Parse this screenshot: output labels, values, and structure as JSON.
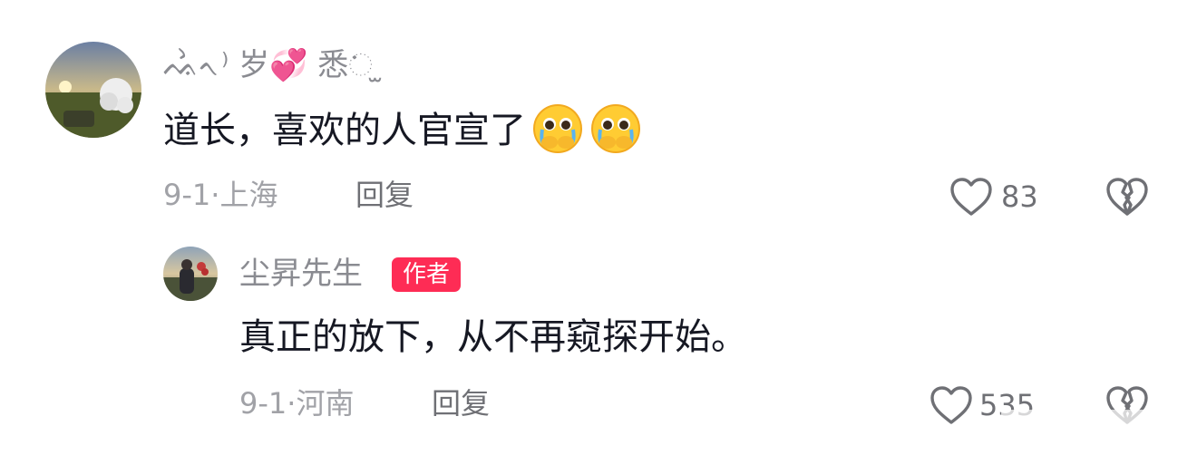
{
  "comment": {
    "username": "ᨕᨛᨚ⁾ 岁💞 悉ᨗ ̫",
    "text": "道长，喜欢的人官宣了",
    "emojis": [
      "pleading-crying-face",
      "pleading-crying-face"
    ],
    "date": "9-1",
    "separator": "·",
    "location": "上海",
    "reply_label": "回复",
    "like_count": "83"
  },
  "reply": {
    "username": "尘昇先生",
    "badge": "作者",
    "text": "真正的放下，从不再窥探开始。",
    "date": "9-1",
    "separator": "·",
    "location": "河南",
    "reply_label": "回复",
    "like_count": "535"
  },
  "colors": {
    "badge": "#fe2c55",
    "username": "#8a8b91",
    "meta": "#a1a2a7",
    "text": "#161823"
  }
}
